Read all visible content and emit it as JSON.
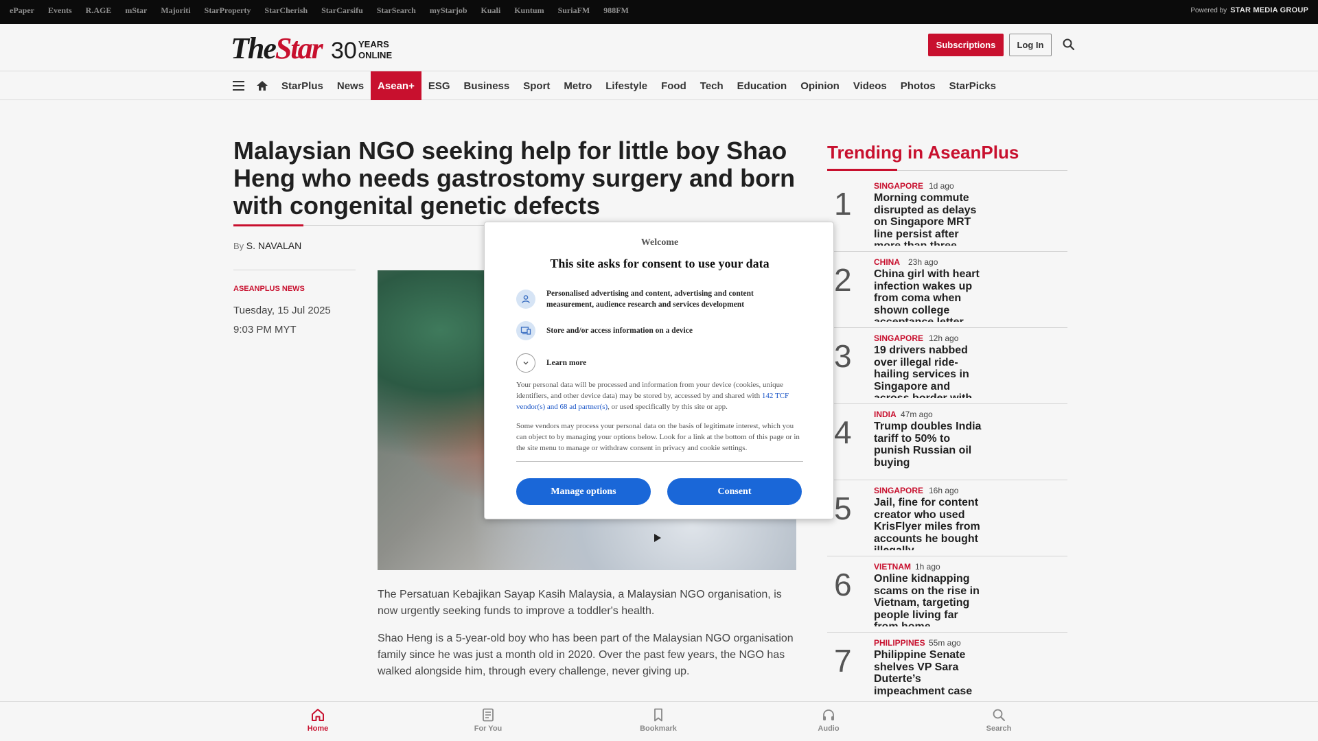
{
  "topbar": {
    "links": [
      "ePaper",
      "Events",
      "R.AGE",
      "mStar",
      "Majoriti",
      "StarProperty",
      "StarCherish",
      "StarCarsifu",
      "StarSearch",
      "myStarjob",
      "Kuali",
      "Kuntum",
      "SuriaFM",
      "988FM"
    ],
    "powered_prefix": "Powered by",
    "powered_brand": "STAR MEDIA GROUP"
  },
  "header": {
    "logo_text": "TheStar",
    "logo_number": "30",
    "logo_years": "YEARS",
    "logo_online": "ONLINE",
    "subscriptions_label": "Subscriptions",
    "login_label": "Log In"
  },
  "nav": {
    "items": [
      "StarPlus",
      "News",
      "Asean+",
      "ESG",
      "Business",
      "Sport",
      "Metro",
      "Lifestyle",
      "Food",
      "Tech",
      "Education",
      "Opinion",
      "Videos",
      "Photos",
      "StarPicks"
    ],
    "active_index": 2
  },
  "article": {
    "headline": "Malaysian NGO seeking help for little boy Shao Heng who needs gastrostomy surgery and born with congenital genetic defects",
    "by_prefix": "By",
    "author": "S. NAVALAN",
    "category": "ASEANPLUS NEWS",
    "date": "Tuesday, 15 Jul 2025",
    "time": "9:03 PM MYT",
    "paragraphs": [
      "The Persatuan Kebajikan Sayap Kasih Malaysia, a Malaysian NGO organisation, is now urgently seeking funds to improve a toddler's health.",
      "Shao Heng is a 5-year-old boy who has been part of the Malaysian NGO organisation family since he was just a month old in 2020. Over the past few years, the NGO has walked alongside him, through every challenge, never giving up."
    ]
  },
  "trending": {
    "title": "Trending in AseanPlus",
    "items": [
      {
        "num": "1",
        "category": "SINGAPORE",
        "time": "1d ago",
        "text": "Morning commute disrupted as delays on Singapore MRT line persist after more than three"
      },
      {
        "num": "2",
        "category": "CHINA",
        "time": "23h ago",
        "text": "China girl with heart infection wakes up from coma when shown college acceptance letter"
      },
      {
        "num": "3",
        "category": "SINGAPORE",
        "time": "12h ago",
        "text": "19 drivers nabbed over illegal ride-hailing services in Singapore and across border with"
      },
      {
        "num": "4",
        "category": "INDIA",
        "time": "47m ago",
        "text": "Trump doubles India tariff to 50% to punish Russian oil buying"
      },
      {
        "num": "5",
        "category": "SINGAPORE",
        "time": "16h ago",
        "text": "Jail, fine for content creator who used KrisFlyer miles from accounts he bought illegally"
      },
      {
        "num": "6",
        "category": "VIETNAM",
        "time": "1h ago",
        "text": "Online kidnapping scams on the rise in Vietnam, targeting people living far from home"
      },
      {
        "num": "7",
        "category": "PHILIPPINES",
        "time": "55m ago",
        "text": "Philippine Senate shelves VP Sara Duterte’s impeachment case"
      }
    ]
  },
  "bottombar": {
    "items": [
      "Home",
      "For You",
      "Bookmark",
      "Audio",
      "Search"
    ]
  },
  "consent": {
    "welcome": "Welcome",
    "title": "This site asks for consent to use your data",
    "purpose_1": "Personalised advertising and content, advertising and content measurement, audience research and services development",
    "purpose_2": "Store and/or access information on a device",
    "learn_more": "Learn more",
    "body_1_a": "Your personal data will be processed and information from your device (cookies, unique identifiers, and other device data) may be stored by, accessed by and shared with ",
    "body_1_link": "142 TCF vendor(s) and 68 ad partner(s)",
    "body_1_b": ", or used specifically by this site or app.",
    "body_2": "Some vendors may process your personal data on the basis of legitimate interest, which you can object to by managing your options below. Look for a link at the bottom of this page or in the site menu to manage or withdraw consent in privacy and cookie settings.",
    "manage_label": "Manage options",
    "consent_label": "Consent"
  },
  "colors": {
    "brand_red": "#c8102e",
    "consent_blue": "#1a67d8"
  }
}
